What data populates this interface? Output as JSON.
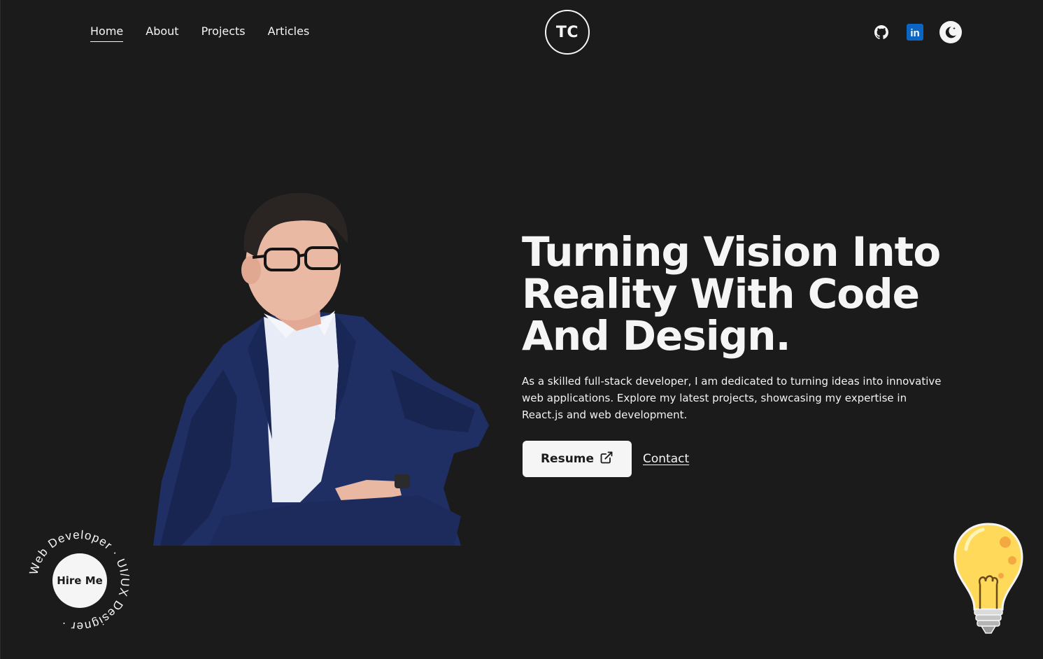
{
  "nav": {
    "links": [
      {
        "label": "Home",
        "active": true
      },
      {
        "label": "About",
        "active": false
      },
      {
        "label": "Projects",
        "active": false
      },
      {
        "label": "Articles",
        "active": false
      }
    ]
  },
  "logo": {
    "text": "TC"
  },
  "social": {
    "icons": [
      "github-icon",
      "linkedin-icon",
      "theme-toggle-moon-icon"
    ],
    "linkedin_glyph": "in"
  },
  "hero": {
    "headline": "Turning Vision Into Reality With Code And Design.",
    "intro": "As a skilled full-stack developer, I am dedicated to turning ideas into innovative web applications. Explore my latest projects, showcasing my expertise in React.js and web development.",
    "resume_label": "Resume",
    "contact_label": "Contact"
  },
  "badge": {
    "button_label": "Hire Me",
    "ring_text": "Web Developer · UI/UX Designer ·"
  },
  "colors": {
    "background": "#1b1b1b",
    "foreground": "#f5f5f5",
    "linkedin_blue": "#0a66c2",
    "bulb_yellow": "#ffd95a",
    "bulb_orange": "#f4a940"
  }
}
